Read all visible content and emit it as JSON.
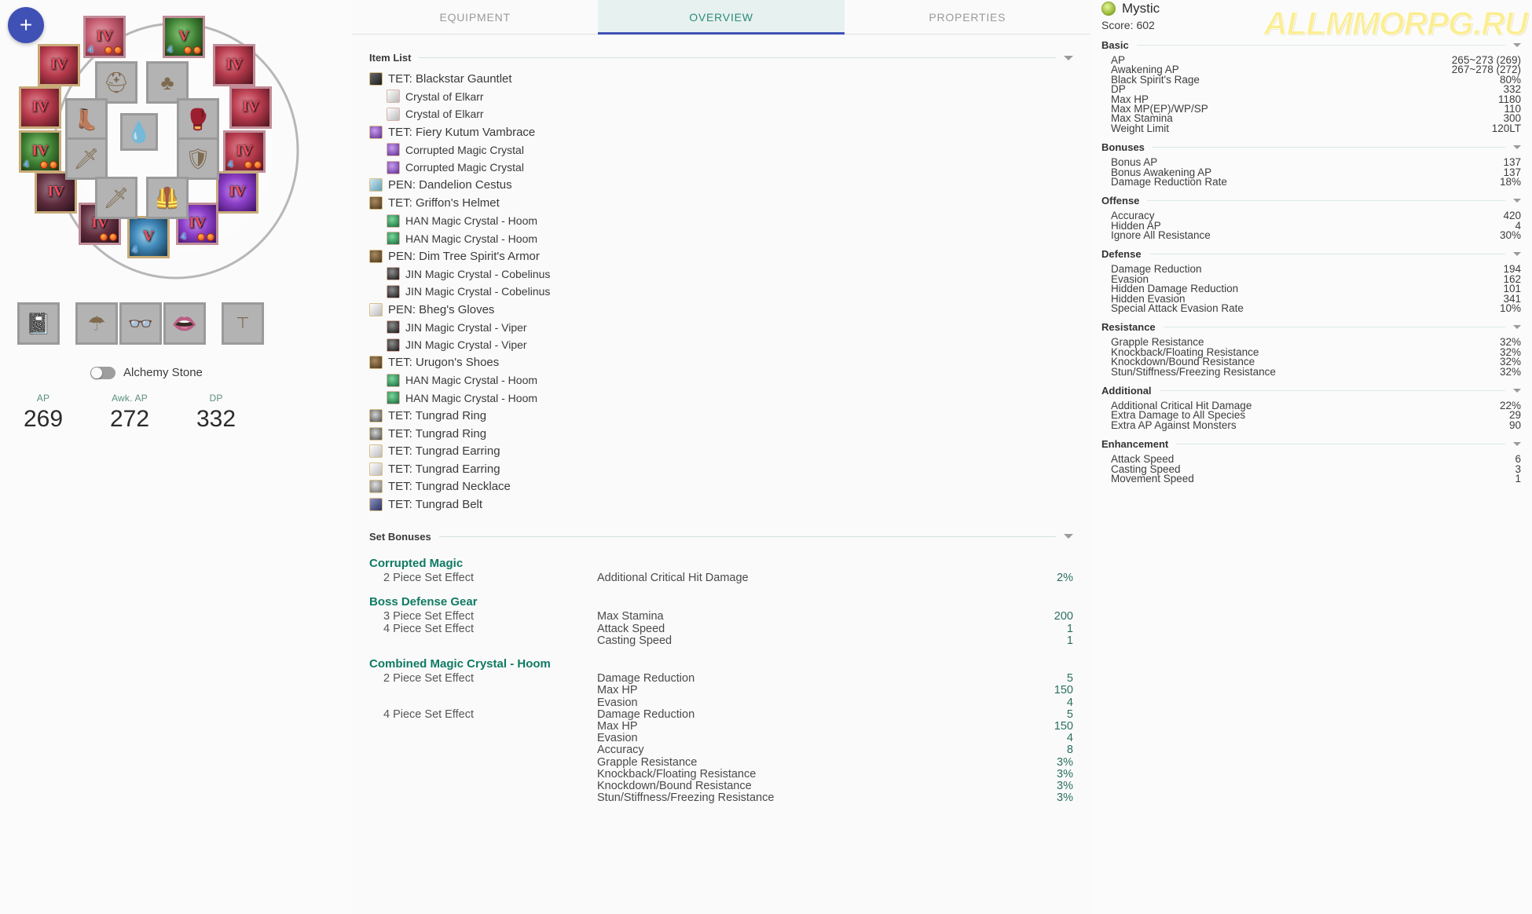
{
  "left": {
    "add_button_label": "+",
    "alchemy_toggle_label": "Alchemy Stone",
    "gear_slots": [
      {
        "name": "main-weapon",
        "enh": "IV",
        "corner": "4",
        "gems": 2,
        "art": "a-red",
        "equipped": true,
        "pinkbg": true
      },
      {
        "name": "helmet",
        "enh": "V",
        "corner": "4",
        "gems": 2,
        "art": "a-green",
        "equipped": true,
        "pinkbg": true
      },
      {
        "name": "sub-weapon",
        "enh": "IV",
        "corner": "",
        "gems": 0,
        "art": "a-crimson",
        "equipped": true,
        "pinkbg": false
      },
      {
        "name": "awakening-weapon",
        "enh": "IV",
        "corner": "",
        "gems": 0,
        "art": "a-crimson",
        "equipped": true,
        "pinkbg": false
      },
      {
        "name": "ring-left",
        "enh": "IV",
        "corner": "",
        "gems": 0,
        "art": "a-crimson",
        "equipped": true,
        "pinkbg": false
      },
      {
        "name": "ring-right",
        "enh": "IV",
        "corner": "",
        "gems": 0,
        "art": "a-crimson",
        "equipped": true,
        "pinkbg": false
      },
      {
        "name": "earring-left",
        "enh": "IV",
        "corner": "4",
        "gems": 2,
        "art": "a-green",
        "equipped": true,
        "pinkbg": false
      },
      {
        "name": "earring-right",
        "enh": "IV",
        "corner": "4",
        "gems": 2,
        "art": "a-crimson",
        "equipped": true,
        "pinkbg": true
      },
      {
        "name": "necklace",
        "enh": "IV",
        "corner": "",
        "gems": 0,
        "art": "a-dark",
        "equipped": true,
        "pinkbg": false
      },
      {
        "name": "belt",
        "enh": "IV",
        "corner": "",
        "gems": 0,
        "art": "a-purple",
        "equipped": true,
        "pinkbg": false
      },
      {
        "name": "gloves",
        "enh": "IV",
        "corner": "",
        "gems": 2,
        "art": "a-dark",
        "equipped": true,
        "pinkbg": true
      },
      {
        "name": "shoes",
        "enh": "V",
        "corner": "4",
        "gems": 0,
        "art": "a-blue",
        "equipped": true,
        "pinkbg": false
      }
    ],
    "inner_slots": [
      {
        "name": "inner-helmet",
        "glyph": "⛑"
      },
      {
        "name": "inner-armor",
        "glyph": "♣"
      },
      {
        "name": "inner-shoes",
        "glyph": "👢"
      },
      {
        "name": "inner-gloves",
        "glyph": "🥊"
      },
      {
        "name": "inner-mainhand",
        "glyph": "🗡"
      },
      {
        "name": "inner-offhand",
        "glyph": "🛡"
      },
      {
        "name": "inner-awakening",
        "glyph": "🗡"
      },
      {
        "name": "inner-vest",
        "glyph": "🦺"
      },
      {
        "name": "inner-center",
        "glyph": "💧"
      }
    ],
    "accessory_slots": [
      {
        "name": "tome-slot",
        "glyph": "📓"
      },
      {
        "name": "earring-accessory-slot",
        "glyph": "☂"
      },
      {
        "name": "glasses-slot",
        "glyph": "👓"
      },
      {
        "name": "lips-slot",
        "glyph": "👄"
      },
      {
        "name": "extra-slot",
        "glyph": "⊤"
      }
    ],
    "stats": [
      {
        "label": "AP",
        "value": "269"
      },
      {
        "label": "Awk. AP",
        "value": "272"
      },
      {
        "label": "DP",
        "value": "332"
      }
    ]
  },
  "center": {
    "tabs": [
      {
        "label": "EQUIPMENT",
        "active": false
      },
      {
        "label": "OVERVIEW",
        "active": true
      },
      {
        "label": "PROPERTIES",
        "active": false
      }
    ],
    "item_list_title": "Item List",
    "items": [
      {
        "name": "TET: Blackstar Gauntlet",
        "level": 0,
        "icon": "i-dark"
      },
      {
        "name": "Crystal of Elkarr",
        "level": 1,
        "icon": "i-silver"
      },
      {
        "name": "Crystal of Elkarr",
        "level": 1,
        "icon": "i-silver"
      },
      {
        "name": "TET: Fiery Kutum Vambrace",
        "level": 0,
        "icon": "i-purple"
      },
      {
        "name": "Corrupted Magic Crystal",
        "level": 1,
        "icon": "i-purple"
      },
      {
        "name": "Corrupted Magic Crystal",
        "level": 1,
        "icon": "i-purple"
      },
      {
        "name": "PEN: Dandelion Cestus",
        "level": 0,
        "icon": "i-teal"
      },
      {
        "name": "TET: Griffon's Helmet",
        "level": 0,
        "icon": "i-brown"
      },
      {
        "name": "HAN Magic Crystal - Hoom",
        "level": 1,
        "icon": "i-green"
      },
      {
        "name": "HAN Magic Crystal - Hoom",
        "level": 1,
        "icon": "i-green"
      },
      {
        "name": "PEN: Dim Tree Spirit's Armor",
        "level": 0,
        "icon": "i-brown"
      },
      {
        "name": "JIN Magic Crystal - Cobelinus",
        "level": 1,
        "icon": "i-black"
      },
      {
        "name": "JIN Magic Crystal - Cobelinus",
        "level": 1,
        "icon": "i-black"
      },
      {
        "name": "PEN: Bheg's Gloves",
        "level": 0,
        "icon": "i-silver"
      },
      {
        "name": "JIN Magic Crystal - Viper",
        "level": 1,
        "icon": "i-black"
      },
      {
        "name": "JIN Magic Crystal - Viper",
        "level": 1,
        "icon": "i-black"
      },
      {
        "name": "TET: Urugon's Shoes",
        "level": 0,
        "icon": "i-brown"
      },
      {
        "name": "HAN Magic Crystal - Hoom",
        "level": 1,
        "icon": "i-green"
      },
      {
        "name": "HAN Magic Crystal - Hoom",
        "level": 1,
        "icon": "i-green"
      },
      {
        "name": "TET: Tungrad Ring",
        "level": 0,
        "icon": "i-flame"
      },
      {
        "name": "TET: Tungrad Ring",
        "level": 0,
        "icon": "i-flame"
      },
      {
        "name": "TET: Tungrad Earring",
        "level": 0,
        "icon": "i-silver"
      },
      {
        "name": "TET: Tungrad Earring",
        "level": 0,
        "icon": "i-silver"
      },
      {
        "name": "TET: Tungrad Necklace",
        "level": 0,
        "icon": "i-crest"
      },
      {
        "name": "TET: Tungrad Belt",
        "level": 0,
        "icon": "i-navy"
      }
    ],
    "set_bonuses_title": "Set Bonuses",
    "set_bonuses": [
      {
        "name": "Corrupted Magic",
        "tiers": [
          {
            "piece": "2 Piece Set Effect",
            "effects": [
              {
                "name": "Additional Critical Hit Damage",
                "value": "2%"
              }
            ]
          }
        ]
      },
      {
        "name": "Boss Defense Gear",
        "tiers": [
          {
            "piece": "3 Piece Set Effect",
            "effects": [
              {
                "name": "Max Stamina",
                "value": "200"
              }
            ]
          },
          {
            "piece": "4 Piece Set Effect",
            "effects": [
              {
                "name": "Attack Speed",
                "value": "1"
              },
              {
                "name": "Casting Speed",
                "value": "1"
              }
            ]
          }
        ]
      },
      {
        "name": "Combined Magic Crystal - Hoom",
        "tiers": [
          {
            "piece": "2 Piece Set Effect",
            "effects": [
              {
                "name": "Damage Reduction",
                "value": "5"
              },
              {
                "name": "Max HP",
                "value": "150"
              },
              {
                "name": "Evasion",
                "value": "4"
              }
            ]
          },
          {
            "piece": "4 Piece Set Effect",
            "effects": [
              {
                "name": "Damage Reduction",
                "value": "5"
              },
              {
                "name": "Max HP",
                "value": "150"
              },
              {
                "name": "Evasion",
                "value": "4"
              },
              {
                "name": "Accuracy",
                "value": "8"
              },
              {
                "name": "Grapple Resistance",
                "value": "3%"
              },
              {
                "name": "Knockback/Floating Resistance",
                "value": "3%"
              },
              {
                "name": "Knockdown/Bound Resistance",
                "value": "3%"
              },
              {
                "name": "Stun/Stiffness/Freezing Resistance",
                "value": "3%"
              }
            ]
          }
        ]
      }
    ]
  },
  "right": {
    "class_name": "Mystic",
    "score_label": "Score:",
    "score_value": "602",
    "watermark": "ALLMMORPG.RU",
    "sections": [
      {
        "title": "Basic",
        "rows": [
          {
            "label": "AP",
            "value": "265~273 (269)"
          },
          {
            "label": "Awakening AP",
            "value": "267~278 (272)"
          },
          {
            "label": "Black Spirit's Rage",
            "value": "80%"
          },
          {
            "label": "DP",
            "value": "332"
          },
          {
            "label": "Max HP",
            "value": "1180"
          },
          {
            "label": "Max MP(EP)/WP/SP",
            "value": "110"
          },
          {
            "label": "Max Stamina",
            "value": "300"
          },
          {
            "label": "Weight Limit",
            "value": "120LT"
          }
        ]
      },
      {
        "title": "Bonuses",
        "rows": [
          {
            "label": "Bonus AP",
            "value": "137"
          },
          {
            "label": "Bonus Awakening AP",
            "value": "137"
          },
          {
            "label": "Damage Reduction Rate",
            "value": "18%"
          }
        ]
      },
      {
        "title": "Offense",
        "rows": [
          {
            "label": "Accuracy",
            "value": "420"
          },
          {
            "label": "Hidden AP",
            "value": "4"
          },
          {
            "label": "Ignore All Resistance",
            "value": "30%"
          }
        ]
      },
      {
        "title": "Defense",
        "rows": [
          {
            "label": "Damage Reduction",
            "value": "194"
          },
          {
            "label": "Evasion",
            "value": "162"
          },
          {
            "label": "Hidden Damage Reduction",
            "value": "101"
          },
          {
            "label": "Hidden Evasion",
            "value": "341"
          },
          {
            "label": "Special Attack Evasion Rate",
            "value": "10%"
          }
        ]
      },
      {
        "title": "Resistance",
        "rows": [
          {
            "label": "Grapple Resistance",
            "value": "32%"
          },
          {
            "label": "Knockback/Floating Resistance",
            "value": "32%"
          },
          {
            "label": "Knockdown/Bound Resistance",
            "value": "32%"
          },
          {
            "label": "Stun/Stiffness/Freezing Resistance",
            "value": "32%"
          }
        ]
      },
      {
        "title": "Additional",
        "rows": [
          {
            "label": "Additional Critical Hit Damage",
            "value": "22%"
          },
          {
            "label": "Extra Damage to All Species",
            "value": "29"
          },
          {
            "label": "Extra AP Against Monsters",
            "value": "90"
          }
        ]
      },
      {
        "title": "Enhancement",
        "rows": [
          {
            "label": "Attack Speed",
            "value": "6"
          },
          {
            "label": "Casting Speed",
            "value": "3"
          },
          {
            "label": "Movement Speed",
            "value": "1"
          }
        ]
      }
    ]
  }
}
